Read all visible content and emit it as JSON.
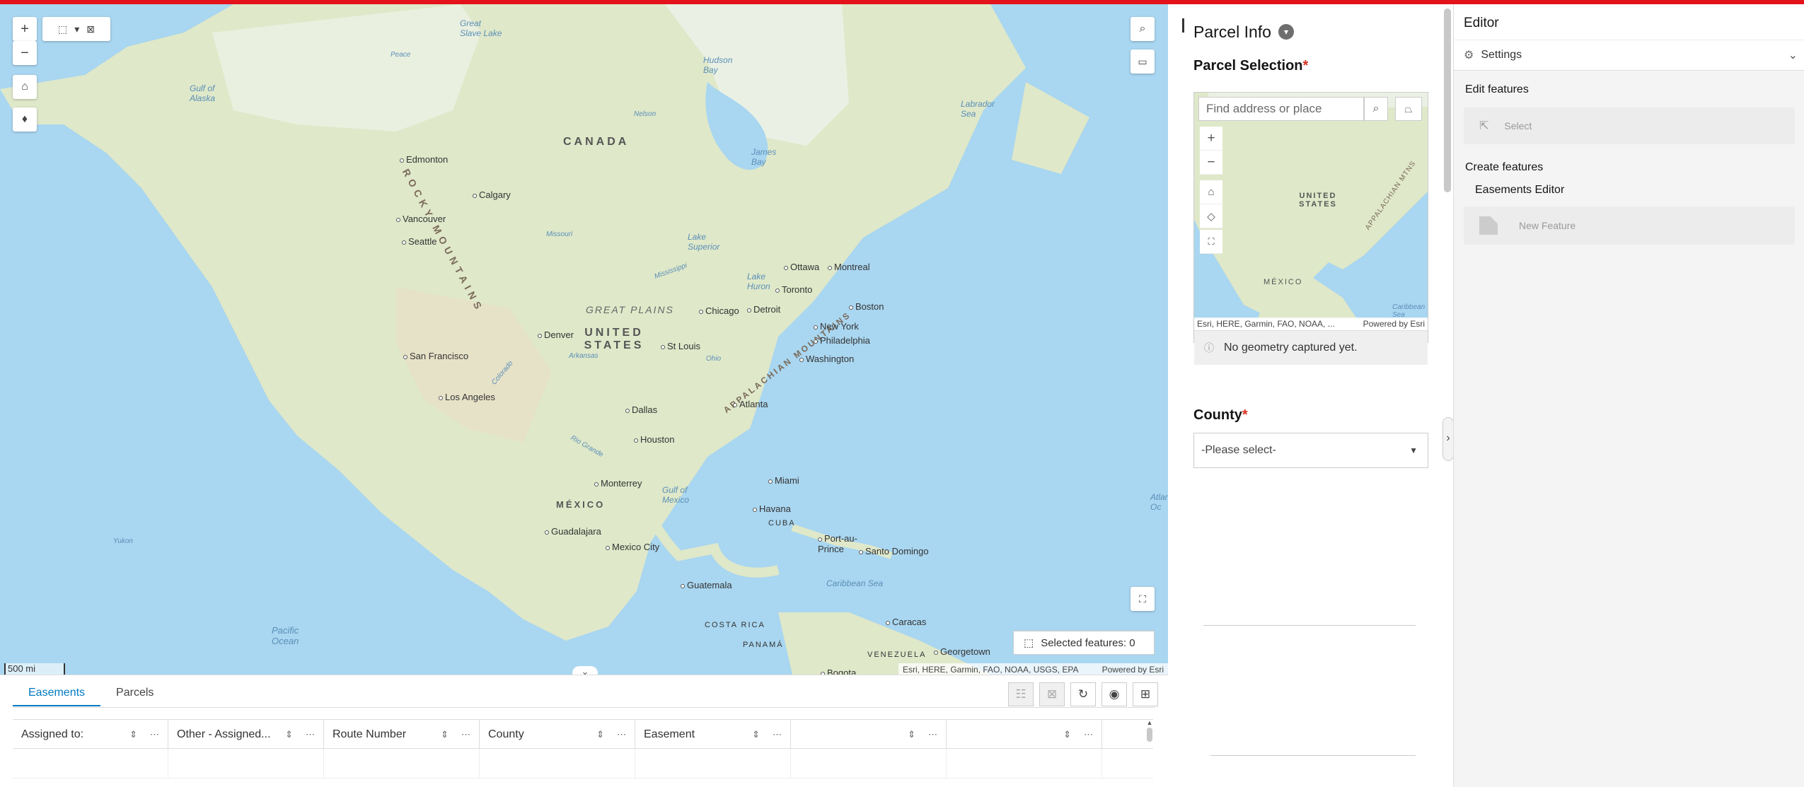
{
  "map": {
    "labels": {
      "canada": "CANADA",
      "united_states": "UNITED STATES",
      "mexico": "MÉXICO",
      "great_plains": "GREAT PLAINS",
      "rocky_mountains": "ROCKY MOUNTAINS",
      "appalachian": "APPALACHIAN MOUNTAINS",
      "cuba": "CUBA",
      "panama": "PANAMÁ",
      "costa_rica": "COSTA RICA",
      "venezuela": "VENEZUELA",
      "great_slave_lake": "Great Slave Lake",
      "hudson_bay": "Hudson Bay",
      "james_bay": "James Bay",
      "labrador_sea": "Labrador Sea",
      "gulf_alaska": "Gulf of Alaska",
      "gulf_mexico": "Gulf of Mexico",
      "caribbean": "Caribbean Sea",
      "pacific": "Pacific Ocean",
      "atlantic": "Atlantic Oc",
      "lake_superior": "Lake Superior",
      "lake_huron": "Lake Huron",
      "missouri": "Missouri",
      "mississippi": "Mississippi",
      "arkansas": "Arkansas",
      "rio_grande": "Rio Grande",
      "peace": "Peace",
      "nelson": "Nelson",
      "colorado": "Colorado",
      "ohio": "Ohio",
      "yukon": "Yukon"
    },
    "cities": [
      "Edmonton",
      "Calgary",
      "Vancouver",
      "Seattle",
      "San Francisco",
      "Los Angeles",
      "Denver",
      "Dallas",
      "Houston",
      "Chicago",
      "St Louis",
      "Detroit",
      "Toronto",
      "Ottawa",
      "Montreal",
      "Boston",
      "New York",
      "Philadelphia",
      "Washington",
      "Atlanta",
      "Miami",
      "Havana",
      "Monterrey",
      "Guadalajara",
      "Mexico City",
      "Guatemala",
      "Port-au-Prince",
      "Santo Domingo",
      "Caracas",
      "Georgetown",
      "Bogota"
    ],
    "scale": "500 mi",
    "attribution": "Esri, HERE, Garmin, FAO, NOAA, USGS, EPA",
    "powered_by": "Powered by Esri",
    "selected_features": "Selected features: 0"
  },
  "table": {
    "tabs": [
      "Easements",
      "Parcels"
    ],
    "columns": [
      "Assigned to:",
      "Other - Assigned...",
      "Route Number",
      "County",
      "Easement",
      "",
      ""
    ]
  },
  "parcel": {
    "title": "Parcel Info",
    "selection_label": "Parcel Selection",
    "required_mark": "*",
    "search_placeholder": "Find address or place",
    "minimap_labels": {
      "us": "UNITED STATES",
      "mexico": "MÉXICO",
      "mtns": "APPALACHIAN MTNS",
      "caribbean": "Caribbean Sea"
    },
    "minimap_attribution": "Esri, HERE, Garmin, FAO, NOAA, ...",
    "minimap_powered": "Powered by Esri",
    "no_geometry": "No geometry captured yet.",
    "county_label": "County",
    "county_value": "-Please select-"
  },
  "editor": {
    "title": "Editor",
    "settings": "Settings",
    "edit_features": "Edit features",
    "select": "Select",
    "create_features": "Create features",
    "layer": "Easements Editor",
    "new_feature": "New Feature"
  }
}
